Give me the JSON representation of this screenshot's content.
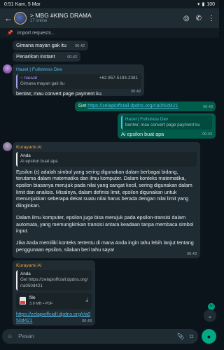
{
  "status": {
    "time": "0:51",
    "date": "Kam, 5 Mar",
    "battery": "100"
  },
  "header": {
    "title": "> MBG #KING DRAMA",
    "subtitle": "17 online"
  },
  "pinned": {
    "text": "import requests..."
  },
  "messages": {
    "m1": {
      "text": "Gimana mayan gak itu",
      "time": "00.42"
    },
    "m2": {
      "text": "Penarikan instant",
      "time": "00.42"
    },
    "m3": {
      "sender": "Hazel | Fullstress Dev",
      "quote_name": "~ nauval",
      "quote_phone": "+62 857-5193-2381",
      "quote_text": "Gimana mayan gak itu",
      "text": "bentwr, mau convert page payment ku",
      "time": "00.42"
    },
    "m4": {
      "prefix": "Get ",
      "link": "https://zelapioffciall.dpdns.org/r/a050d421",
      "time": "00.43"
    },
    "m5": {
      "quote_name": "Hazel | Fullstress Dev",
      "quote_text": "bentwr, mau convert page payment ku",
      "text": "Ai epsilon buat apa",
      "time": "00.43"
    },
    "m6": {
      "sender": "Kurayami AI",
      "quote_name": "Anda",
      "quote_text": "Ai epsilon buat apa",
      "p1": "Epsilon (ε) adalah simbol yang sering digunakan dalam berbagai bidang, terutama dalam matematika dan ilmu komputer. Dalam konteks matematika, epsilon biasanya merujuk pada nilai yang sangat kecil, sering digunakan dalam limit dan analisis. Misalnya, dalam definisi limit, epsilon digunakan untuk menunjukkan seberapa dekat suatu nilai harus berada dengan nilai limit yang diinginkan.",
      "p2": "Dalam ilmu komputer, epsilon juga bisa merujuk pada epsilon-transisi dalam automata, yang memungkinkan transisi antara keadaan tanpa membaca simbol input.",
      "p3": "Jika Anda memiliki konteks tertentu di mana Anda ingin tahu lebih lanjut tentang penggunaan epsilon, silakan beri tahu saya!",
      "time": "00.43"
    },
    "m7": {
      "sender": "Kurayami AI",
      "quote_name": "Anda",
      "quote_text": "Get https://zelapioffciall.dpdns.org/r/a050d421",
      "file_name": "file",
      "file_meta": "3,8 MB • PDF",
      "link": "https://zelapioffciall.dpdns.org/r/a050d421",
      "time": "00.43"
    }
  },
  "input": {
    "placeholder": "Pesan"
  },
  "unread_count": "30"
}
